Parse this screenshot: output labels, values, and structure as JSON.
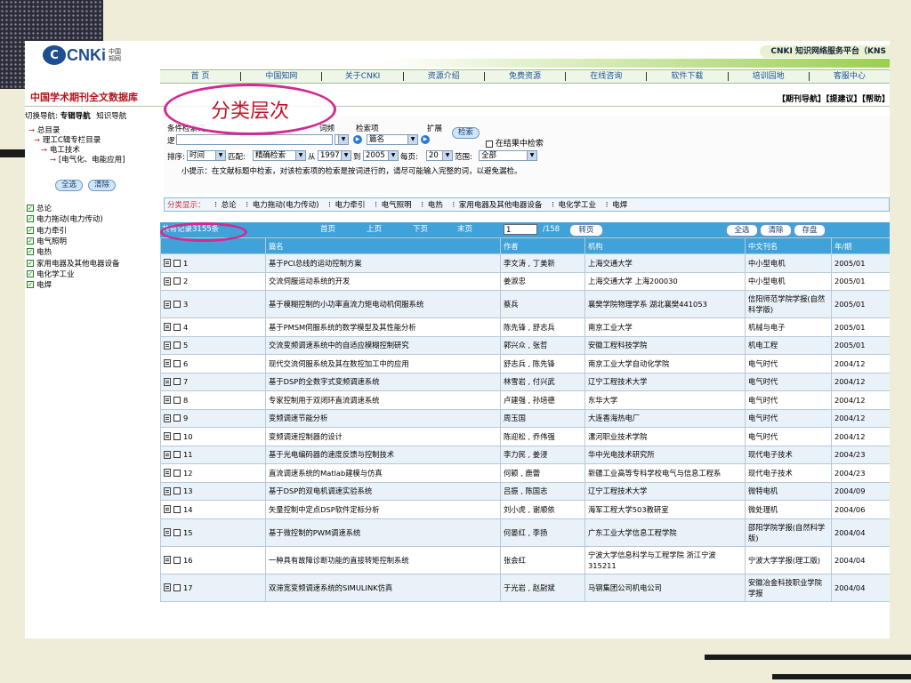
{
  "header": {
    "logo_text": "CNKi",
    "logo_cn": "中国知网",
    "platform": "CNKI 知识网络服务平台（KNS"
  },
  "nav": [
    "首 页",
    "中国知网",
    "关于CNKI",
    "资源介绍",
    "免费资源",
    "在线咨询",
    "软件下载",
    "培训园地",
    "客服中心"
  ],
  "db_title": "中国学术期刊全文数据库",
  "toplinks": "【期刊导航】【提建议】【帮助】",
  "left_nav": {
    "tabs_prefix": "切换导航:",
    "tab_active": "专辑导航",
    "tab_other": "知识导航",
    "tree": [
      "总目录",
      "理工C辑专栏目录",
      "电工技术",
      "[电气化、电能应用]"
    ],
    "btn_all": "全选",
    "btn_clear": "清除"
  },
  "search": {
    "cond_label": "条件检索词",
    "prefix": "逻",
    "input_value": "",
    "word_label": "词频",
    "field_label": "检索项",
    "expand_label": "扩展",
    "field_value": "篇名",
    "search_btn": "检索",
    "in_result": "在结果中检索",
    "sort_label": "排序:",
    "sort_value": "时间",
    "match_label": "匹配:",
    "match_value": "精确检索",
    "from_label": "从",
    "year_from": "1997",
    "to_label": "到",
    "year_to": "2005",
    "per_page_label": "每页:",
    "per_page": "20",
    "range_label": "范围:",
    "range_value": "全部",
    "tip": "小提示：在文献标题中检索，对该检索项的检索是按词进行的，请尽可能输入完整的词，以避免漏检。"
  },
  "categories": {
    "label": "分类显示：",
    "items": [
      "总论",
      "电力拖动(电力传动)",
      "电力牵引",
      "电气照明",
      "电热",
      "家用电器及其他电器设备",
      "电化学工业",
      "电焊"
    ]
  },
  "left_list": [
    "总论",
    "电力拖动(电力传动)",
    "电力牵引",
    "电气照明",
    "电热",
    "家用电器及其他电器设备",
    "电化学工业",
    "电焊"
  ],
  "result_bar": {
    "count": "共有记录3155条",
    "first": "首页",
    "prev": "上页",
    "next": "下页",
    "last": "末页",
    "page": "1",
    "total": "/158",
    "go": "转页",
    "select_all": "全选",
    "clear": "清除",
    "save": "存盘"
  },
  "table": {
    "headers": [
      "",
      "篇名",
      "作者",
      "机构",
      "中文刊名",
      "年/期"
    ],
    "rows": [
      {
        "no": "1",
        "title": "基于PCI总线的运动控制方案",
        "author": "李文涛 , 丁美新",
        "org": "上海交通大学",
        "journal": "中小型电机",
        "year": "2005/01"
      },
      {
        "no": "2",
        "title": "交流伺服运动系统的开发",
        "author": "姜淑忠",
        "org": "上海交通大学 上海200030",
        "journal": "中小型电机",
        "year": "2005/01"
      },
      {
        "no": "3",
        "title": "基于模糊控制的小功率直流力矩电动机伺服系统",
        "author": "蔡兵",
        "org": "襄樊学院物理学系 湖北襄樊441053",
        "journal": "信阳师范学院学报(自然科学版)",
        "year": "2005/01"
      },
      {
        "no": "4",
        "title": "基于PMSM伺服系统的数学模型及其性能分析",
        "author": "陈先锋 , 舒志兵",
        "org": "南京工业大学",
        "journal": "机械与电子",
        "year": "2005/01"
      },
      {
        "no": "5",
        "title": "交流变频调速系统中的自适应模糊控制研究",
        "author": "郭兴众 , 张哲",
        "org": "安徽工程科技学院",
        "journal": "机电工程",
        "year": "2005/01"
      },
      {
        "no": "6",
        "title": "现代交流伺服系统及其在数控加工中的应用",
        "author": "舒志兵 , 陈先锋",
        "org": "南京工业大学自动化学院",
        "journal": "电气时代",
        "year": "2004/12"
      },
      {
        "no": "7",
        "title": "基于DSP的全数字式变频调速系统",
        "author": "林雪岩 , 付兴武",
        "org": "辽宁工程技术大学",
        "journal": "电气时代",
        "year": "2004/12"
      },
      {
        "no": "8",
        "title": "专家控制用于双闭环直流调速系统",
        "author": "卢建强 , 孙培德",
        "org": "东华大学",
        "journal": "电气时代",
        "year": "2004/12"
      },
      {
        "no": "9",
        "title": "变频调速节能分析",
        "author": "周玉国",
        "org": "大连香海热电厂",
        "journal": "电气时代",
        "year": "2004/12"
      },
      {
        "no": "10",
        "title": "变频调速控制器的设计",
        "author": "陈迎松 , 乔伟强",
        "org": "漯河职业技术学院",
        "journal": "电气时代",
        "year": "2004/12"
      },
      {
        "no": "11",
        "title": "基于光电编码器的速度反馈与控制技术",
        "author": "李力民 , 姜浸",
        "org": "华中光电技术研究所",
        "journal": "现代电子技术",
        "year": "2004/23"
      },
      {
        "no": "12",
        "title": "直流调速系统的Matlab建模与仿真",
        "author": "何颖 , 鹿蕾",
        "org": "新疆工业高等专科学校电气与信息工程系",
        "journal": "现代电子技术",
        "year": "2004/23"
      },
      {
        "no": "13",
        "title": "基于DSP的双电机调速实验系统",
        "author": "吕振 , 陈国志",
        "org": "辽宁工程技术大学",
        "journal": "微特电机",
        "year": "2004/09"
      },
      {
        "no": "14",
        "title": "矢量控制中定点DSP软件定标分析",
        "author": "刘小虎 , 谢顺依",
        "org": "海军工程大学503教研室",
        "journal": "微处理机",
        "year": "2004/06"
      },
      {
        "no": "15",
        "title": "基于微控制的PWM调速系统",
        "author": "何晏红 , 李扬",
        "org": "广东工业大学信息工程学院",
        "journal": "邵阳学院学报(自然科学版)",
        "year": "2004/04"
      },
      {
        "no": "16",
        "title": "一种具有故障诊断功能的直接转矩控制系统",
        "author": "张会红",
        "org": "宁波大学信息科学与工程学院 浙江宁波315211",
        "journal": "宁波大学学报(理工版)",
        "year": "2004/04"
      },
      {
        "no": "17",
        "title": "双滞宽变频调速系统的SIMULINK仿真",
        "author": "于光岩 , 赵尉斌",
        "org": "马钢集团公司机电公司",
        "journal": "安徽冶金科技职业学院学报",
        "year": "2004/04"
      }
    ]
  },
  "annotation": "分类层次",
  "colors": {
    "brand": "#1d4e8f",
    "accent_red": "#b2161d",
    "result_bar": "#3fa2d8",
    "callout": "#d22a92"
  }
}
